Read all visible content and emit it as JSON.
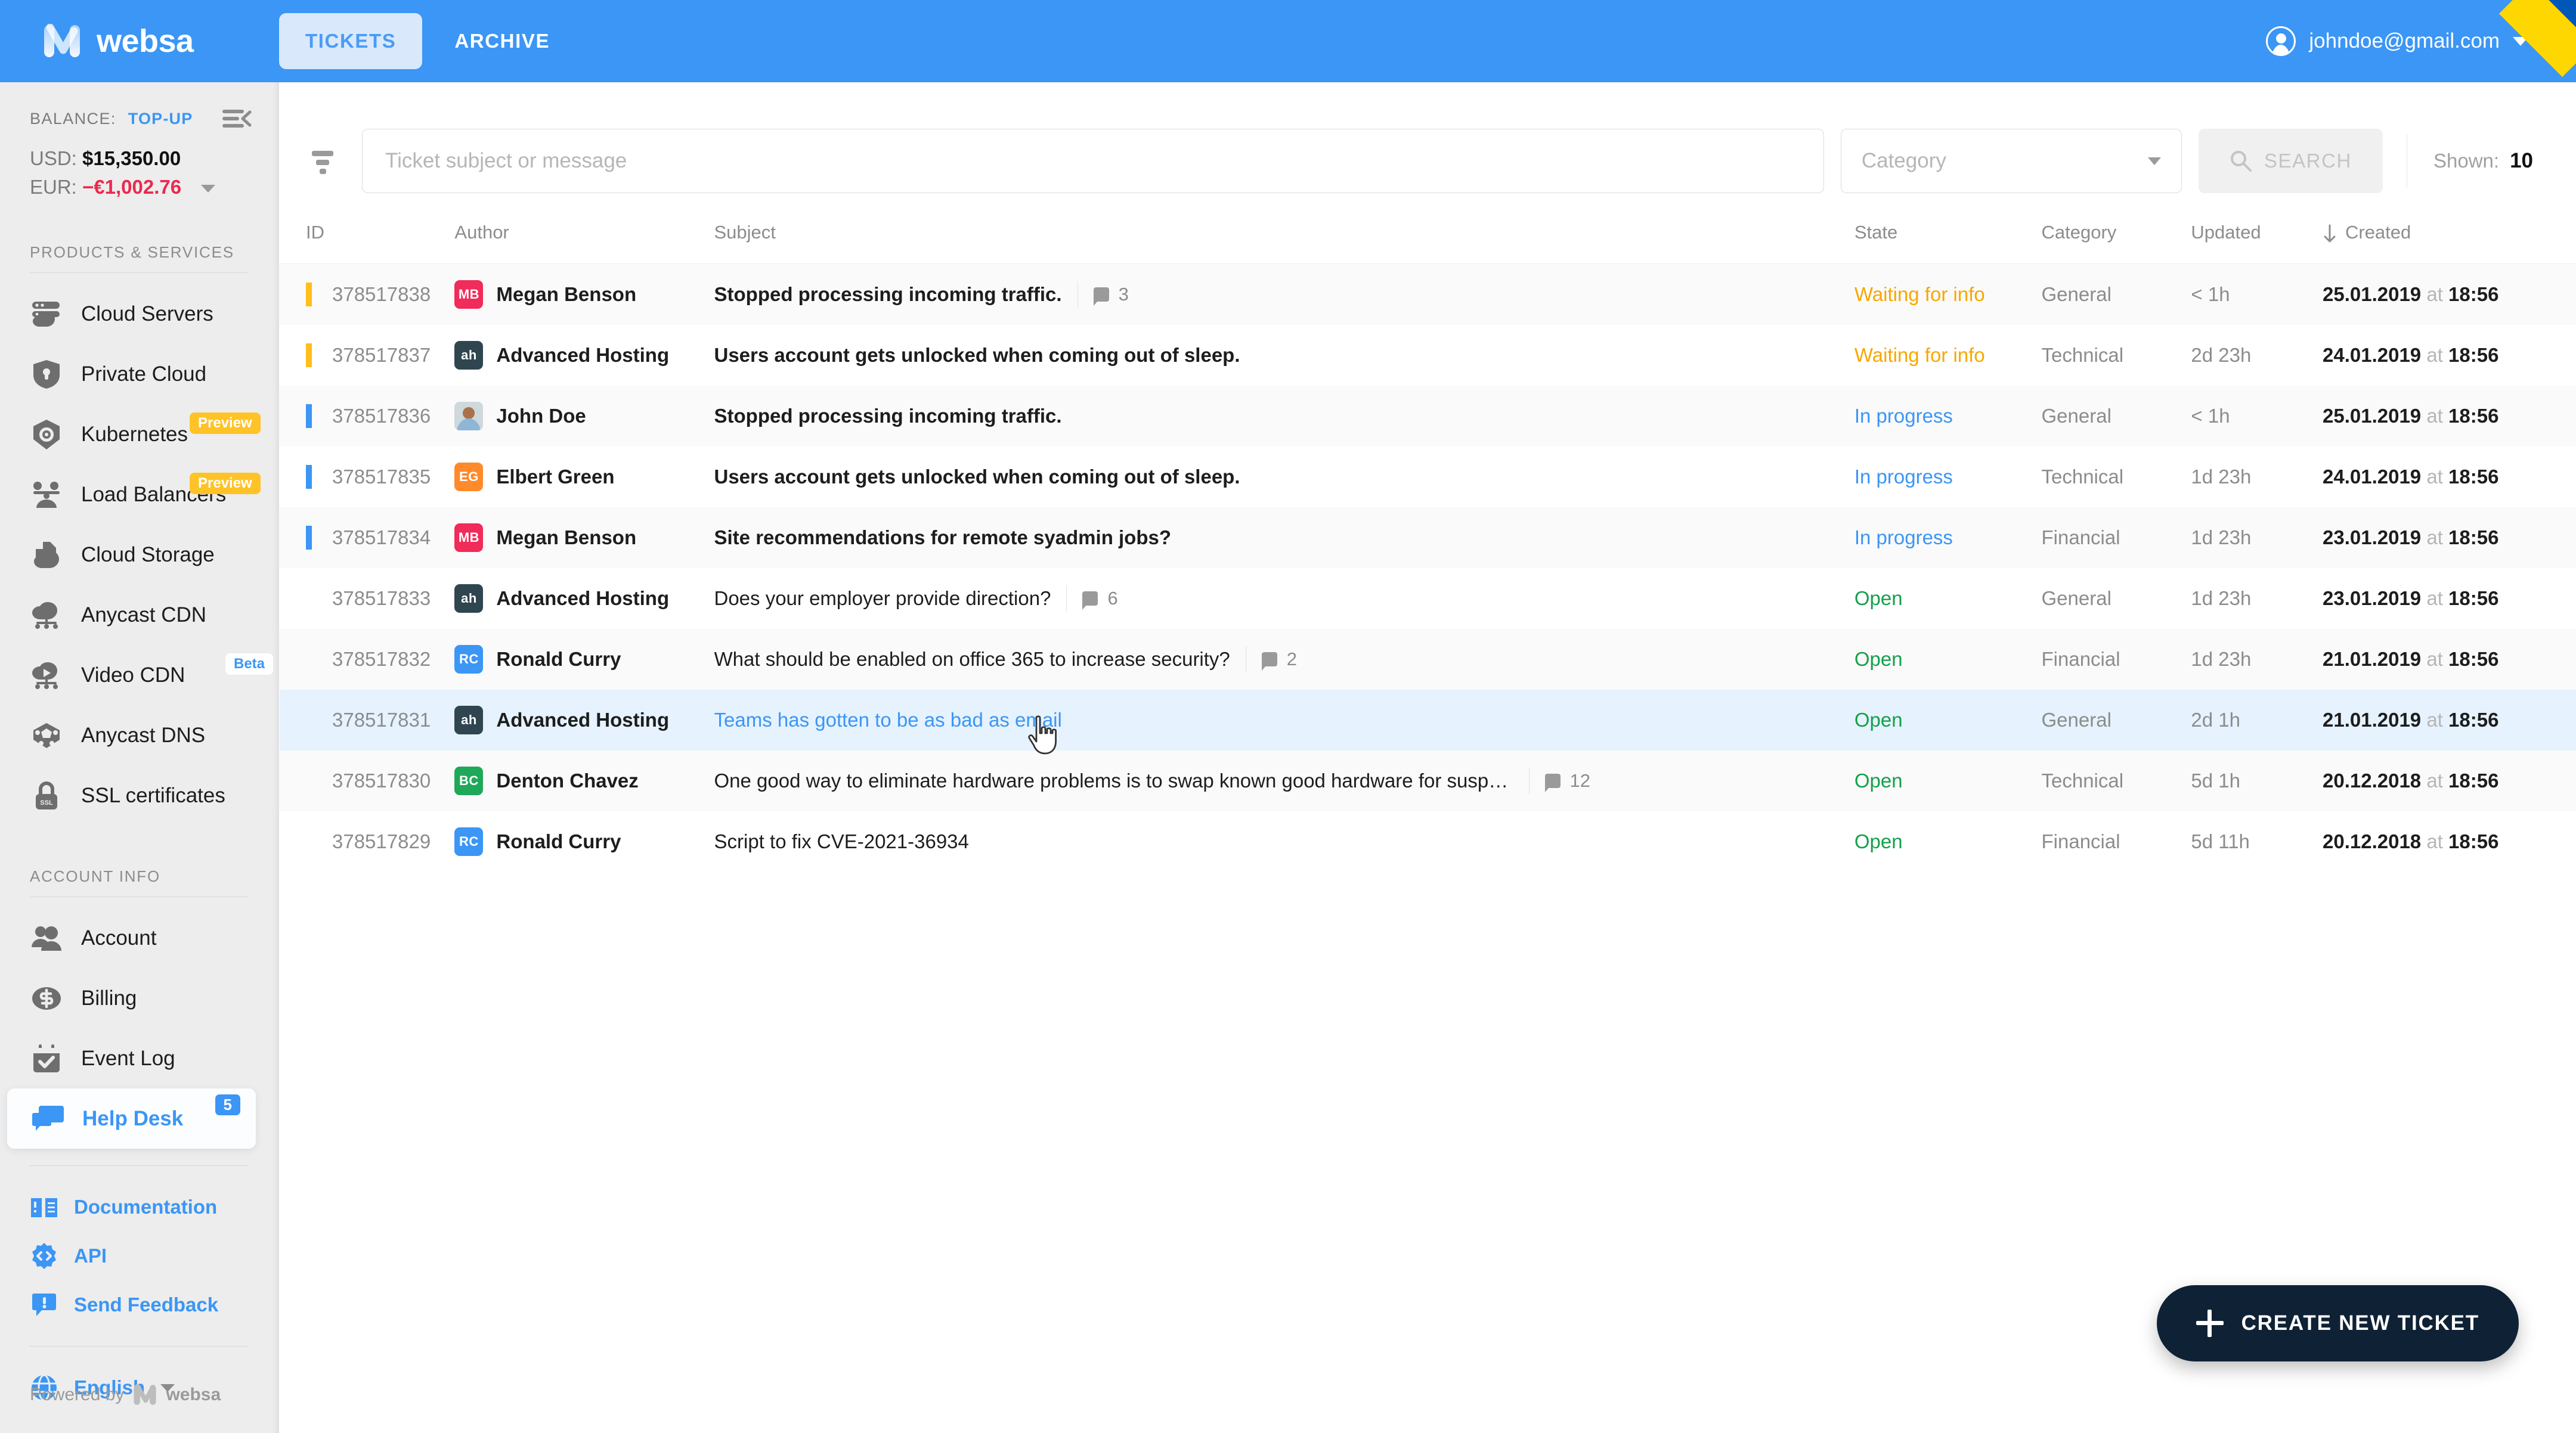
{
  "brand": {
    "name": "websa",
    "logo_icon": "websa-logo-icon"
  },
  "topbar": {
    "tabs": [
      {
        "label": "TICKETS",
        "active": true
      },
      {
        "label": "ARCHIVE",
        "active": false
      }
    ],
    "user_email": "johndoe@gmail.com",
    "account_icon": "user-circle-icon",
    "caret_icon": "chevron-down-icon",
    "ribbon_colors": {
      "top": "#0057b7",
      "bottom": "#ffd700"
    }
  },
  "sidebar": {
    "balance": {
      "label": "BALANCE:",
      "topup_label": "TOP-UP",
      "usd_label": "USD:",
      "usd_value": "$15,350.00",
      "eur_label": "EUR:",
      "eur_value": "−€1,002.76",
      "collapse_icon": "collapse-sidebar-icon"
    },
    "products_title": "PRODUCTS & SERVICES",
    "products": [
      {
        "label": "Cloud Servers",
        "icon": "cloud-servers-icon",
        "badge": ""
      },
      {
        "label": "Private Cloud",
        "icon": "shield-lock-icon",
        "badge": ""
      },
      {
        "label": "Kubernetes",
        "icon": "kubernetes-icon",
        "badge": "Preview",
        "badge_type": "preview"
      },
      {
        "label": "Load Balancers",
        "icon": "load-balancer-icon",
        "badge": "Preview",
        "badge_type": "preview"
      },
      {
        "label": "Cloud Storage",
        "icon": "cloud-storage-icon",
        "badge": ""
      },
      {
        "label": "Anycast CDN",
        "icon": "anycast-cdn-icon",
        "badge": ""
      },
      {
        "label": "Video CDN",
        "icon": "video-cdn-icon",
        "badge": "Beta",
        "badge_type": "beta"
      },
      {
        "label": "Anycast DNS",
        "icon": "anycast-dns-icon",
        "badge": ""
      },
      {
        "label": "SSL certificates",
        "icon": "ssl-lock-icon",
        "badge": ""
      }
    ],
    "account_title": "ACCOUNT INFO",
    "account": [
      {
        "label": "Account",
        "icon": "users-icon",
        "badge": ""
      },
      {
        "label": "Billing",
        "icon": "dollar-icon",
        "badge": ""
      },
      {
        "label": "Event Log",
        "icon": "calendar-check-icon",
        "badge": ""
      },
      {
        "label": "Help Desk",
        "icon": "chat-bubbles-icon",
        "badge": "5",
        "active": true
      }
    ],
    "links": [
      {
        "label": "Documentation",
        "icon": "book-icon"
      },
      {
        "label": "API",
        "icon": "gear-code-icon"
      },
      {
        "label": "Send Feedback",
        "icon": "feedback-icon"
      }
    ],
    "language": {
      "label": "English",
      "icon": "globe-icon",
      "caret_icon": "chevron-down-icon"
    },
    "powered_by": {
      "prefix": "Powered by",
      "name": "websa",
      "icon": "websa-logo-icon"
    }
  },
  "toolbar": {
    "filter_icon": "filter-icon",
    "search_placeholder": "Ticket subject or message",
    "search_value": "",
    "category_placeholder": "Category",
    "category_value": "",
    "search_button_label": "SEARCH",
    "search_button_icon": "search-icon",
    "shown_label": "Shown:",
    "shown_value": "10"
  },
  "table": {
    "columns": [
      {
        "key": "id",
        "label": "ID"
      },
      {
        "key": "author",
        "label": "Author"
      },
      {
        "key": "subject",
        "label": "Subject"
      },
      {
        "key": "state",
        "label": "State"
      },
      {
        "key": "category",
        "label": "Category"
      },
      {
        "key": "updated",
        "label": "Updated"
      },
      {
        "key": "created",
        "label": "Created",
        "sorted": true,
        "sort_dir": "desc",
        "sort_icon": "arrow-down-icon"
      }
    ],
    "rows": [
      {
        "id": "378517838",
        "author": "Megan Benson",
        "avatar": "MB",
        "avatar_color": "#f12b5a",
        "avatar_type": "initials",
        "subject": "Stopped processing incoming traffic.",
        "subject_bold": true,
        "comments": "3",
        "state": "Waiting for info",
        "state_type": "waiting",
        "category": "General",
        "updated": "< 1h",
        "created_date": "25.01.2019",
        "created_at_word": "at",
        "created_time": "18:56",
        "accent": "#ffbe1a"
      },
      {
        "id": "378517837",
        "author": "Advanced Hosting",
        "avatar": "ah",
        "avatar_color": "#2f4550",
        "avatar_type": "initials",
        "subject": "Users account gets unlocked when coming out of sleep.",
        "subject_bold": true,
        "comments": "",
        "state": "Waiting for info",
        "state_type": "waiting",
        "category": "Technical",
        "updated": "2d 23h",
        "created_date": "24.01.2019",
        "created_at_word": "at",
        "created_time": "18:56",
        "accent": "#ffbe1a"
      },
      {
        "id": "378517836",
        "author": "John Doe",
        "avatar": "",
        "avatar_color": "#cfd8dc",
        "avatar_type": "photo",
        "subject": "Stopped processing incoming traffic.",
        "subject_bold": true,
        "comments": "",
        "state": "In progress",
        "state_type": "progress",
        "category": "General",
        "updated": "< 1h",
        "created_date": "25.01.2019",
        "created_at_word": "at",
        "created_time": "18:56",
        "accent": "#3b96f5"
      },
      {
        "id": "378517835",
        "author": "Elbert Green",
        "avatar": "EG",
        "avatar_color": "#ff8a2b",
        "avatar_type": "initials",
        "subject": "Users account gets unlocked when coming out of sleep.",
        "subject_bold": true,
        "comments": "",
        "state": "In progress",
        "state_type": "progress",
        "category": "Technical",
        "updated": "1d 23h",
        "created_date": "24.01.2019",
        "created_at_word": "at",
        "created_time": "18:56",
        "accent": "#3b96f5"
      },
      {
        "id": "378517834",
        "author": "Megan Benson",
        "avatar": "MB",
        "avatar_color": "#f12b5a",
        "avatar_type": "initials",
        "subject": "Site recommendations for remote syadmin jobs?",
        "subject_bold": true,
        "comments": "",
        "state": "In progress",
        "state_type": "progress",
        "category": "Financial",
        "updated": "1d 23h",
        "created_date": "23.01.2019",
        "created_at_word": "at",
        "created_time": "18:56",
        "accent": "#3b96f5"
      },
      {
        "id": "378517833",
        "author": "Advanced Hosting",
        "avatar": "ah",
        "avatar_color": "#2f4550",
        "avatar_type": "initials",
        "subject": "Does your employer provide direction?",
        "subject_bold": false,
        "comments": "6",
        "state": "Open",
        "state_type": "open",
        "category": "General",
        "updated": "1d 23h",
        "created_date": "23.01.2019",
        "created_at_word": "at",
        "created_time": "18:56",
        "accent": ""
      },
      {
        "id": "378517832",
        "author": "Ronald Curry",
        "avatar": "RC",
        "avatar_color": "#3b96f5",
        "avatar_type": "initials",
        "subject": "What should be enabled on office 365 to increase security?",
        "subject_bold": false,
        "comments": "2",
        "state": "Open",
        "state_type": "open",
        "category": "Financial",
        "updated": "1d 23h",
        "created_date": "21.01.2019",
        "created_at_word": "at",
        "created_time": "18:56",
        "accent": ""
      },
      {
        "id": "378517831",
        "author": "Advanced Hosting",
        "avatar": "ah",
        "avatar_color": "#2f4550",
        "avatar_type": "initials",
        "subject": "Teams has gotten to be as bad as email",
        "subject_bold": false,
        "comments": "",
        "state": "Open",
        "state_type": "open",
        "category": "General",
        "updated": "2d 1h",
        "created_date": "21.01.2019",
        "created_at_word": "at",
        "created_time": "18:56",
        "accent": "",
        "hovered": true
      },
      {
        "id": "378517830",
        "author": "Denton Chavez",
        "avatar": "BC",
        "avatar_color": "#1fa85a",
        "avatar_type": "initials",
        "subject": "One good way to eliminate hardware problems is to swap known good hardware for suspected bad. For example, sup…",
        "subject_bold": false,
        "comments": "12",
        "state": "Open",
        "state_type": "open",
        "category": "Technical",
        "updated": "5d 1h",
        "created_date": "20.12.2018",
        "created_at_word": "at",
        "created_time": "18:56",
        "accent": ""
      },
      {
        "id": "378517829",
        "author": "Ronald Curry",
        "avatar": "RC",
        "avatar_color": "#3b96f5",
        "avatar_type": "initials",
        "subject": "Script to fix CVE-2021-36934",
        "subject_bold": false,
        "comments": "",
        "state": "Open",
        "state_type": "open",
        "category": "Financial",
        "updated": "5d 11h",
        "created_date": "20.12.2018",
        "created_at_word": "at",
        "created_time": "18:56",
        "accent": ""
      }
    ]
  },
  "fab": {
    "label": "CREATE NEW TICKET",
    "icon": "plus-icon"
  },
  "colors": {
    "brand_blue": "#3b96f5",
    "status_waiting": "#f7a800",
    "status_progress": "#3b96f5",
    "status_open": "#12a04a",
    "negative_red": "#ea2a4f",
    "badge_preview": "#ffc328",
    "fab_dark": "#0f2135"
  }
}
